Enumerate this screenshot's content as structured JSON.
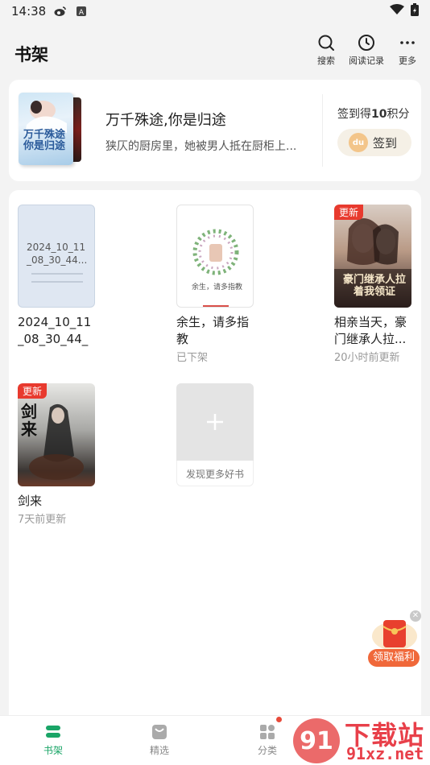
{
  "status_bar": {
    "time": "14:38"
  },
  "header": {
    "title": "书架",
    "search_label": "搜索",
    "history_label": "阅读记录",
    "more_label": "更多"
  },
  "featured": {
    "book_title": "万千殊途,你是归途",
    "description": "狭仄的厨房里，她被男人抵在厨柜上...",
    "cover_text": "万千殊途你是归途",
    "signin_prefix": "签到得",
    "signin_points": "10",
    "signin_suffix": "积分",
    "signin_button": "签到",
    "coin_text": "du"
  },
  "shelf": {
    "books": [
      {
        "title": "2024_10_11_08_30_44_1...",
        "cover_text": "2024_10_11_08_30_44...",
        "sub": "",
        "badge": ""
      },
      {
        "title": "余生，请多指教",
        "cover_text": "余生，请多指教",
        "sub": "已下架",
        "badge": ""
      },
      {
        "title": "相亲当天，豪门继承人拉...",
        "cover_text": "豪门继承人拉着我领证",
        "sub": "20小时前更新",
        "badge": "更新"
      },
      {
        "title": "剑来",
        "cover_text": "剑来",
        "sub": "7天前更新",
        "badge": "更新"
      }
    ],
    "add_more": "发现更多好书"
  },
  "float_gift": {
    "label": "领取福利"
  },
  "tabbar": {
    "items": [
      {
        "label": "书架"
      },
      {
        "label": "精选"
      },
      {
        "label": "分类"
      }
    ]
  },
  "watermark": {
    "main": "下载站",
    "site": "91xz.net",
    "logo": "91"
  },
  "colors": {
    "accent": "#1aa567",
    "badge": "#e83a2e",
    "gift": "#f0683a"
  }
}
